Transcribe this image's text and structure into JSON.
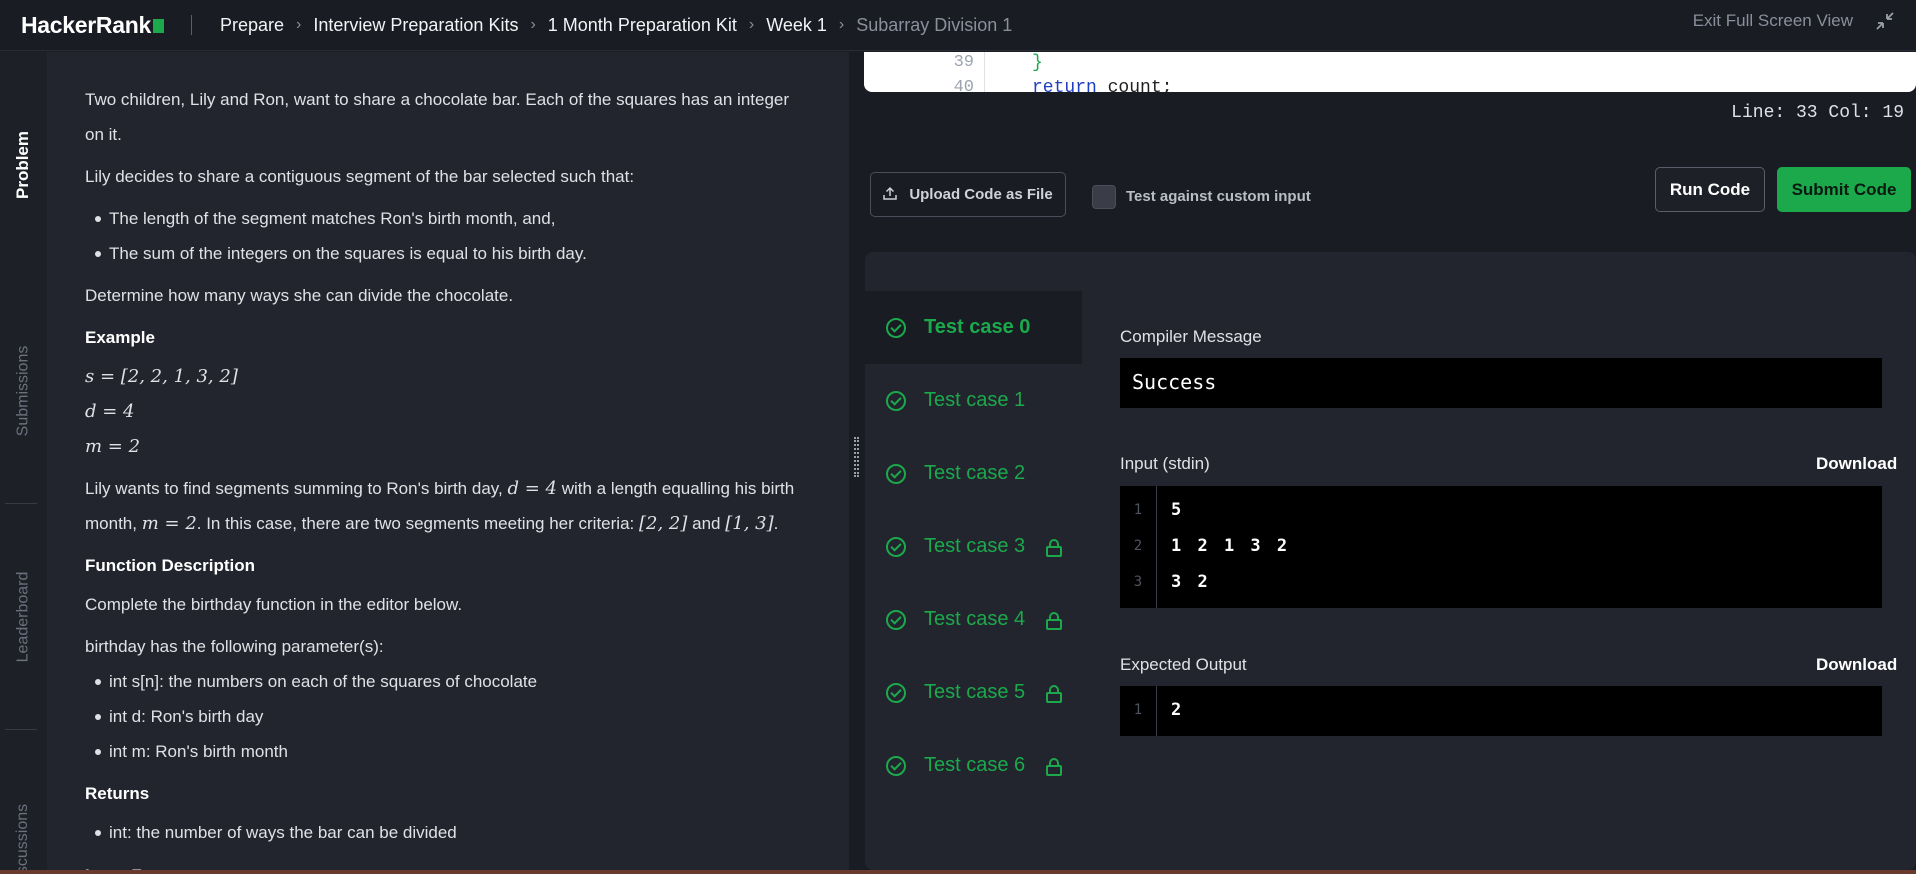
{
  "header": {
    "logo": "HackerRank",
    "breadcrumb": [
      "Prepare",
      "Interview Preparation Kits",
      "1 Month Preparation Kit",
      "Week 1"
    ],
    "current": "Subarray Division 1",
    "exit_fullscreen": "Exit Full Screen View"
  },
  "sidebar_tabs": [
    "Problem",
    "Submissions",
    "Leaderboard",
    "scussions"
  ],
  "problem": {
    "intro": "Two children, Lily and Ron, want to share a chocolate bar. Each of the squares has an integer on it.",
    "decide": "Lily decides to share a contiguous segment of the bar selected such that:",
    "bullets": [
      "The length of the segment matches Ron's birth month, and,",
      "The sum of the integers on the squares is equal to his birth day."
    ],
    "determine": "Determine how many ways she can divide the chocolate.",
    "example_heading": "Example",
    "example_lines": [
      "s = [2, 2, 1, 3, 2]",
      "d = 4",
      "m = 2"
    ],
    "explain_1": "Lily wants to find segments summing to Ron's birth day,",
    "explain_d": "d = 4",
    "explain_2": "with a length equalling his birth month,",
    "explain_m": "m = 2",
    "explain_3": ". In this case, there are two segments meeting her criteria:",
    "explain_seg1": "[2, 2]",
    "explain_and": "and",
    "explain_seg2": "[1, 3]",
    "explain_end": ".",
    "func_heading": "Function Description",
    "func_desc": "Complete the birthday function in the editor below.",
    "params_intro": "birthday has the following parameter(s):",
    "params": [
      "int s[n]: the numbers on each of the squares of chocolate",
      "int d: Ron's birth day",
      "int m: Ron's birth month"
    ],
    "returns_heading": "Returns",
    "returns": [
      "int: the number of ways the bar can be divided"
    ],
    "input_format_heading": "Input Format"
  },
  "editor": {
    "lines": [
      {
        "num": "39",
        "code": "}"
      },
      {
        "num": "40",
        "code": "return count;"
      }
    ],
    "status": "Line: 33 Col: 19"
  },
  "toolbar": {
    "upload_label": "Upload Code as File",
    "custom_input_label": "Test against custom input",
    "run_label": "Run Code",
    "submit_label": "Submit Code"
  },
  "test_cases": [
    {
      "label": "Test case 0",
      "locked": false
    },
    {
      "label": "Test case 1",
      "locked": false
    },
    {
      "label": "Test case 2",
      "locked": false
    },
    {
      "label": "Test case 3",
      "locked": true
    },
    {
      "label": "Test case 4",
      "locked": true
    },
    {
      "label": "Test case 5",
      "locked": true
    },
    {
      "label": "Test case 6",
      "locked": true
    }
  ],
  "result": {
    "compiler_label": "Compiler Message",
    "compiler_message": "Success",
    "input_label": "Input (stdin)",
    "download_label": "Download",
    "input_lines": [
      {
        "num": "1",
        "text": "5"
      },
      {
        "num": "2",
        "text": "1 2 1 3 2"
      },
      {
        "num": "3",
        "text": "3 2"
      }
    ],
    "expected_label": "Expected Output",
    "expected_lines": [
      {
        "num": "1",
        "text": "2"
      }
    ]
  },
  "colors": {
    "accent": "#1ba94c",
    "panel": "#23252e",
    "background": "#1a1c23"
  }
}
